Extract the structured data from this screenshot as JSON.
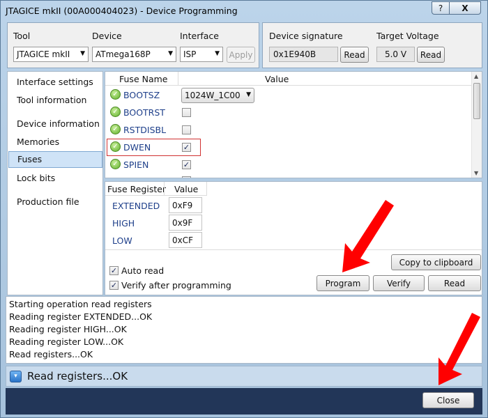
{
  "window": {
    "title": "JTAGICE mkII (00A000404023) - Device Programming",
    "help_glyph": "?",
    "close_glyph": "X"
  },
  "toolbar": {
    "tool_label": "Tool",
    "tool_value": "JTAGICE mkII",
    "device_label": "Device",
    "device_value": "ATmega168P",
    "interface_label": "Interface",
    "interface_value": "ISP",
    "apply_label": "Apply",
    "signature_label": "Device signature",
    "signature_value": "0x1E940B",
    "signature_read": "Read",
    "voltage_label": "Target Voltage",
    "voltage_value": "5.0 V",
    "voltage_read": "Read"
  },
  "sidebar": {
    "items": [
      {
        "label": "Interface settings"
      },
      {
        "label": "Tool information"
      },
      {
        "label": "Device information"
      },
      {
        "label": "Memories"
      },
      {
        "label": "Fuses"
      },
      {
        "label": "Lock bits"
      },
      {
        "label": "Production file"
      }
    ],
    "selected": "Fuses"
  },
  "fuses": {
    "col_name": "Fuse Name",
    "col_value": "Value",
    "rows": [
      {
        "name": "BOOTSZ",
        "value": "1024W_1C00",
        "checked": null
      },
      {
        "name": "BOOTRST",
        "checked": false
      },
      {
        "name": "RSTDISBL",
        "checked": false
      },
      {
        "name": "DWEN",
        "checked": true
      },
      {
        "name": "SPIEN",
        "checked": true
      }
    ],
    "check_glyph": "✓"
  },
  "registers": {
    "col_register": "Fuse Register",
    "col_value": "Value",
    "rows": [
      {
        "name": "EXTENDED",
        "value": "0xF9"
      },
      {
        "name": "HIGH",
        "value": "0x9F"
      },
      {
        "name": "LOW",
        "value": "0xCF"
      }
    ],
    "auto_read_label": "Auto read",
    "auto_read_checked": true,
    "verify_label": "Verify after programming",
    "verify_checked": true,
    "copy_label": "Copy to clipboard",
    "program_label": "Program",
    "verify_button_label": "Verify",
    "read_label": "Read"
  },
  "log": {
    "lines": [
      "Starting operation read registers",
      "Reading register EXTENDED...OK",
      "Reading register HIGH...OK",
      "Reading register LOW...OK",
      "Read registers...OK"
    ]
  },
  "status": {
    "text": "Read registers...OK",
    "expander_glyph": "▾"
  },
  "footer": {
    "close_label": "Close"
  },
  "colors": {
    "annotation_arrow": "#ff0000",
    "selected_row": "#cfe3f7",
    "highlight_border": "#d03030",
    "footer": "#223658"
  }
}
